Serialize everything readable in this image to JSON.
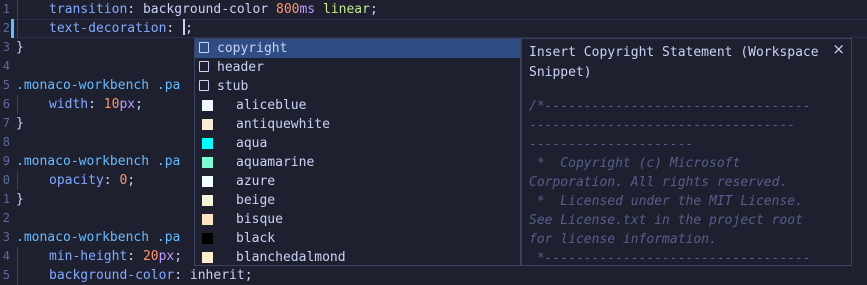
{
  "editor": {
    "lines": [
      {
        "num": "1",
        "tokens": [
          {
            "t": "prop",
            "v": "transition"
          },
          {
            "t": "punc",
            "v": ": "
          },
          {
            "t": "plain",
            "v": "background-color "
          },
          {
            "t": "num",
            "v": "800"
          },
          {
            "t": "unit",
            "v": "ms"
          },
          {
            "t": "plain",
            "v": " "
          },
          {
            "t": "val",
            "v": "linear"
          },
          {
            "t": "punc",
            "v": ";"
          }
        ],
        "indent": 1
      },
      {
        "num": "2",
        "tokens": [
          {
            "t": "prop",
            "v": "text-decoration"
          },
          {
            "t": "punc",
            "v": ": "
          }
        ],
        "indent": 1,
        "cursor": true,
        "after_cursor": ";"
      },
      {
        "num": "3",
        "tokens": [
          {
            "t": "punc",
            "v": "}"
          }
        ],
        "indent": 0
      },
      {
        "num": "4",
        "tokens": [],
        "indent": 0
      },
      {
        "num": "5",
        "tokens": [
          {
            "t": "sel",
            "v": ".monaco-workbench .pa"
          }
        ],
        "indent": 0
      },
      {
        "num": "6",
        "tokens": [
          {
            "t": "prop",
            "v": "width"
          },
          {
            "t": "punc",
            "v": ": "
          },
          {
            "t": "num",
            "v": "10"
          },
          {
            "t": "unit",
            "v": "px"
          },
          {
            "t": "punc",
            "v": ";"
          }
        ],
        "indent": 1
      },
      {
        "num": "7",
        "tokens": [
          {
            "t": "punc",
            "v": "}"
          }
        ],
        "indent": 0
      },
      {
        "num": "8",
        "tokens": [],
        "indent": 0
      },
      {
        "num": "9",
        "tokens": [
          {
            "t": "sel",
            "v": ".monaco-workbench .pa"
          }
        ],
        "indent": 0
      },
      {
        "num": "0",
        "tokens": [
          {
            "t": "prop",
            "v": "opacity"
          },
          {
            "t": "punc",
            "v": ": "
          },
          {
            "t": "num",
            "v": "0"
          },
          {
            "t": "punc",
            "v": ";"
          }
        ],
        "indent": 1
      },
      {
        "num": "1",
        "tokens": [
          {
            "t": "punc",
            "v": "}"
          }
        ],
        "indent": 0
      },
      {
        "num": "2",
        "tokens": [],
        "indent": 0
      },
      {
        "num": "3",
        "tokens": [
          {
            "t": "sel",
            "v": ".monaco-workbench .pa"
          }
        ],
        "indent": 0
      },
      {
        "num": "4",
        "tokens": [
          {
            "t": "prop",
            "v": "min-height"
          },
          {
            "t": "punc",
            "v": ": "
          },
          {
            "t": "num",
            "v": "20"
          },
          {
            "t": "unit",
            "v": "px"
          },
          {
            "t": "punc",
            "v": ";"
          }
        ],
        "indent": 1
      },
      {
        "num": "5",
        "tokens": [
          {
            "t": "prop",
            "v": "background-color"
          },
          {
            "t": "punc",
            "v": ": "
          },
          {
            "t": "plain",
            "v": "inherit"
          },
          {
            "t": "punc",
            "v": ";"
          }
        ],
        "indent": 1
      }
    ]
  },
  "suggest": {
    "items": [
      {
        "kind": "snippet",
        "label": "copyright",
        "selected": true,
        "icon": "snippet-icon"
      },
      {
        "kind": "snippet",
        "label": "header",
        "icon": "snippet-icon"
      },
      {
        "kind": "snippet",
        "label": "stub",
        "icon": "snippet-icon"
      },
      {
        "kind": "color",
        "label": "aliceblue",
        "color": "#f0f8ff"
      },
      {
        "kind": "color",
        "label": "antiquewhite",
        "color": "#faebd7"
      },
      {
        "kind": "color",
        "label": "aqua",
        "color": "#00ffff"
      },
      {
        "kind": "color",
        "label": "aquamarine",
        "color": "#7fffd4"
      },
      {
        "kind": "color",
        "label": "azure",
        "color": "#f0ffff"
      },
      {
        "kind": "color",
        "label": "beige",
        "color": "#f5f5dc"
      },
      {
        "kind": "color",
        "label": "bisque",
        "color": "#ffe4c4"
      },
      {
        "kind": "color",
        "label": "black",
        "color": "#000000"
      },
      {
        "kind": "color",
        "label": "blanchedalmond",
        "color": "#ffebcd"
      }
    ]
  },
  "details": {
    "title": "Insert Copyright Statement (Workspace Snippet)",
    "close_icon": "close-icon",
    "close_glyph": "×",
    "body": "/*----------------------------------\n----------------------------------\n---------------------\n *  Copyright (c) Microsoft\nCorporation. All rights reserved.\n *  Licensed under the MIT License.\nSee License.txt in the project root\nfor license information.\n *----------------------------------"
  },
  "colors": {
    "background": "#1e2030",
    "selected_item": "#2f4d84",
    "modified_gutter": "#65bcff"
  }
}
